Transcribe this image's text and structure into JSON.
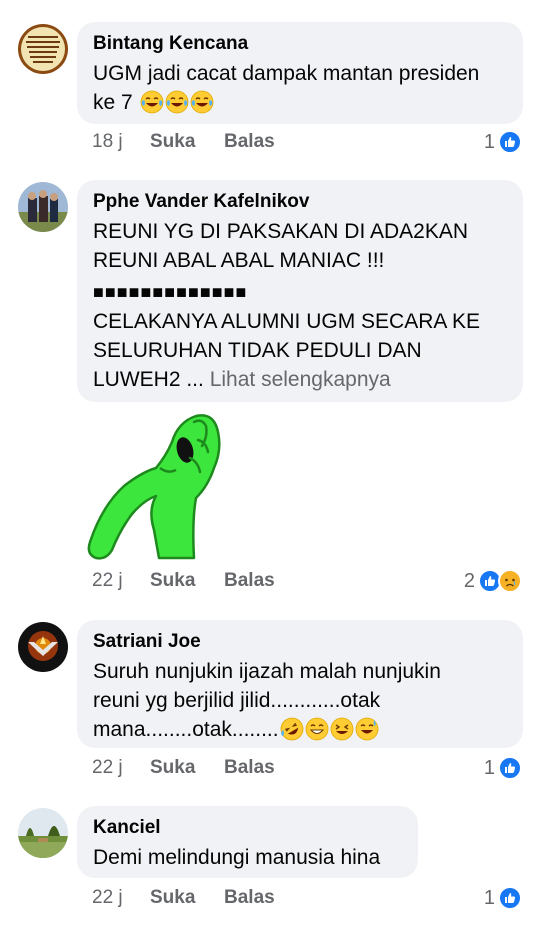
{
  "comments": [
    {
      "author": "Bintang Kencana",
      "text": "UGM jadi cacat dampak mantan presiden ke 7",
      "emoji": [
        "laughing-tears",
        "laughing-tears",
        "laughing-tears"
      ],
      "time": "18 j",
      "like_label": "Suka",
      "reply_label": "Balas",
      "reaction_count": "1",
      "reactions": [
        "like"
      ]
    },
    {
      "author": "Pphe Vander Kafelnikov",
      "line1": "REUNI YG DI PAKSAKAN DI ADA2KAN",
      "line2": "REUNI ABAL ABAL MANIAC !!!",
      "squares": "■■■■■■■■■■■■■",
      "line3": "CELAKANYA ALUMNI UGM SECARA KE",
      "line4": "SELURUHAN TIDAK PEDULI DAN",
      "line5": "LUWEH2 ...",
      "see_more": "Lihat selengkapnya",
      "sticker": "green-facepalm-sticker",
      "time": "22 j",
      "like_label": "Suka",
      "reply_label": "Balas",
      "reaction_count": "2",
      "reactions": [
        "like",
        "sad"
      ]
    },
    {
      "author": "Satriani Joe",
      "line1": "Suruh nunjukin ijazah malah nunjukin",
      "line2": "reuni yg berjilid jilid............otak",
      "line3": "mana........otak........",
      "emoji": [
        "rolling-laughing",
        "grinning",
        "squinting-laugh",
        "sweat-smile"
      ],
      "time": "22 j",
      "like_label": "Suka",
      "reply_label": "Balas",
      "reaction_count": "1",
      "reactions": [
        "like"
      ]
    },
    {
      "author": "Kanciel",
      "text": "Demi melindungi manusia hina",
      "time": "22 j",
      "like_label": "Suka",
      "reply_label": "Balas",
      "reaction_count": "1",
      "reactions": [
        "like"
      ]
    }
  ],
  "colors": {
    "bubble": "#f0f2f5",
    "meta": "#65676b",
    "like_blue": "#1877f2",
    "sticker_green": "#3ce63c"
  }
}
